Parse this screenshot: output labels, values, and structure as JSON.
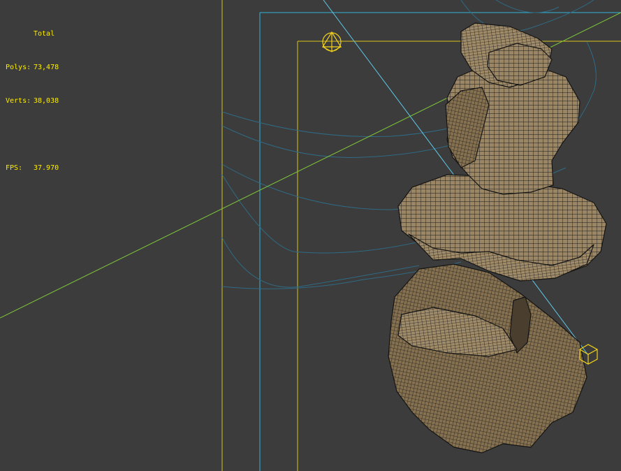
{
  "stats": {
    "header": "Total",
    "polys_label": "Polys:",
    "polys_value": "73,478",
    "verts_label": "Verts:",
    "verts_value": "38,038",
    "fps_label": "FPS:",
    "fps_value": "37.970"
  },
  "colors": {
    "background": "#3c3c3c",
    "stats_text": "#ffee00",
    "safe_frame": "#d9c21a",
    "frustum": "#32b4d8",
    "target_line": "#7fc93a",
    "mesh_fill": "#8e7a5a",
    "wire": "#1a1a1a"
  },
  "icons": {
    "camera_gizmo": "camera-gizmo-icon",
    "target_gizmo": "target-gizmo-icon"
  }
}
